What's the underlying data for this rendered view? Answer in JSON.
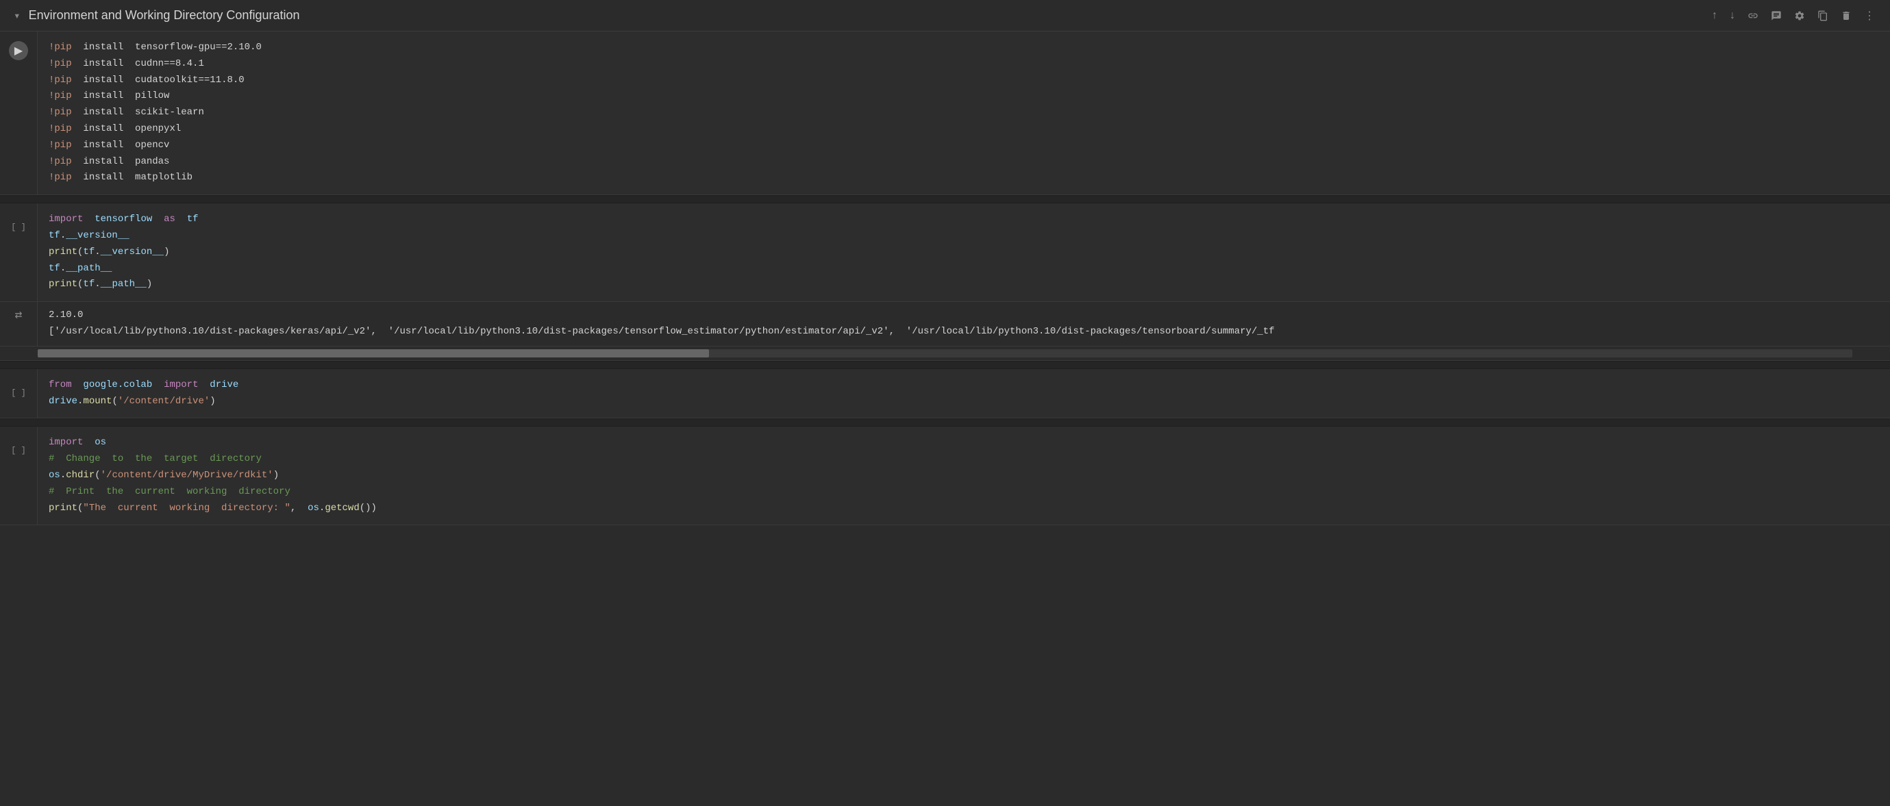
{
  "header": {
    "title": "Environment and Working Directory Configuration",
    "chevron": "▾",
    "toolbar": {
      "up_label": "↑",
      "down_label": "↓",
      "link_label": "🔗",
      "comment_label": "≡",
      "settings_label": "⚙",
      "copy_label": "⧉",
      "delete_label": "🗑",
      "more_label": "⋮"
    }
  },
  "cells": [
    {
      "id": "cell-1",
      "type": "code",
      "gutter": "run",
      "lines": [
        "!pip  install  tensorflow-gpu==2.10.0",
        "!pip  install  cudnn==8.4.1",
        "!pip  install  cudatoolkit==11.8.0",
        "!pip  install  pillow",
        "!pip  install  scikit-learn",
        "!pip  install  openpyxl",
        "!pip  install  opencv",
        "!pip  install  pandas",
        "!pip  install  matplotlib"
      ]
    },
    {
      "id": "cell-2",
      "type": "code",
      "gutter": "[ ]",
      "lines": [
        "import  tensorflow  as  tf",
        "tf.__version__",
        "print(tf.__version__)",
        "tf.__path__",
        "print(tf.__path__)"
      ]
    },
    {
      "id": "output-1",
      "type": "output",
      "lines": [
        "2.10.0",
        "['/usr/local/lib/python3.10/dist-packages/keras/api/_v2',  '/usr/local/lib/python3.10/dist-packages/tensorflow_estimator/python/estimator/api/_v2',  '/usr/local/lib/python3.10/dist-packages/tensorboard/summary/_tf"
      ]
    },
    {
      "id": "cell-3",
      "type": "code",
      "gutter": "[ ]",
      "lines": [
        "from  google.colab  import  drive",
        "drive.mount('/content/drive')"
      ]
    },
    {
      "id": "cell-4",
      "type": "code",
      "gutter": "[ ]",
      "lines": [
        "import  os",
        "#  Change  to  the  target  directory",
        "os.chdir('/content/drive/MyDrive/rdkit')",
        "#  Print  the  current  working  directory",
        "print(\"The  current  working  directory: \",  os.getcwd())"
      ]
    }
  ]
}
